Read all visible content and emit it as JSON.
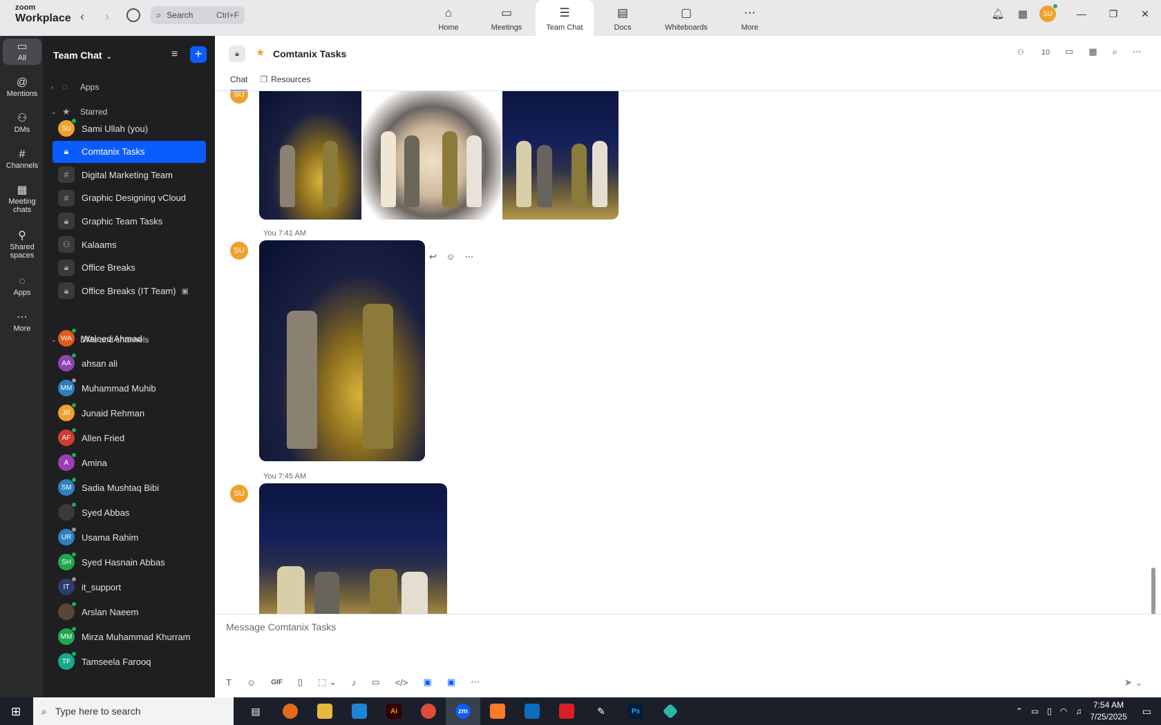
{
  "app": {
    "brand_top": "zoom",
    "brand_bottom": "Workplace"
  },
  "top": {
    "search_label": "Search",
    "search_shortcut": "Ctrl+F",
    "tabs": [
      {
        "label": "Home",
        "icon": "home-icon"
      },
      {
        "label": "Meetings",
        "icon": "video-icon"
      },
      {
        "label": "Team Chat",
        "icon": "chat-icon"
      },
      {
        "label": "Docs",
        "icon": "doc-icon"
      },
      {
        "label": "Whiteboards",
        "icon": "whiteboard-icon"
      },
      {
        "label": "More",
        "icon": "more-icon"
      }
    ],
    "active_tab": "Team Chat",
    "avatar_initials": "SU"
  },
  "rail": [
    {
      "label": "All",
      "icon": "chat-bubble-icon"
    },
    {
      "label": "Mentions",
      "icon": "at-icon"
    },
    {
      "label": "DMs",
      "icon": "people-icon"
    },
    {
      "label": "Channels",
      "icon": "hash-icon"
    },
    {
      "label": "Meeting chats",
      "icon": "calendar-icon"
    },
    {
      "label": "Shared spaces",
      "icon": "share-icon"
    },
    {
      "label": "Apps",
      "icon": "apps-bubble-icon"
    },
    {
      "label": "More",
      "icon": "ellipsis-icon"
    }
  ],
  "sidebar": {
    "title": "Team Chat",
    "sections": {
      "apps": "Apps",
      "starred": "Starred",
      "dms": "DMs and channels"
    },
    "starred": [
      {
        "label": "Sami Ullah (you)",
        "initials": "SU",
        "color": "#f0a02c",
        "kind": "avatar",
        "status": "on"
      },
      {
        "label": "Comtanix Tasks",
        "kind": "lock",
        "active": true
      },
      {
        "label": "Digital Marketing Team",
        "kind": "hash"
      },
      {
        "label": "Graphic Designing vCloud",
        "kind": "hash"
      },
      {
        "label": "Graphic Team Tasks",
        "kind": "lock"
      },
      {
        "label": "Kalaams",
        "kind": "group"
      },
      {
        "label": "Office Breaks",
        "kind": "lock"
      },
      {
        "label": "Office Breaks (IT Team)",
        "kind": "lock",
        "archived": true
      }
    ],
    "dms": [
      {
        "label": "Waleed Ahmad",
        "initials": "WA",
        "color": "#e05a1c",
        "status": "on"
      },
      {
        "label": "ahsan ali",
        "initials": "AA",
        "color": "#8e44ad",
        "status": "on"
      },
      {
        "label": "Muhammad Muhib",
        "initials": "MM",
        "color": "#2d7fc1",
        "status": "off"
      },
      {
        "label": "Junaid Rehman",
        "initials": "JR",
        "color": "#f0a02c",
        "status": "on"
      },
      {
        "label": "Allen Fried",
        "initials": "AF",
        "color": "#d03a2f",
        "status": "on"
      },
      {
        "label": "Amina",
        "initials": "A",
        "color": "#9b3fb5",
        "status": "on"
      },
      {
        "label": "Sadia Mushtaq Bibi",
        "initials": "SM",
        "color": "#2d7fc1",
        "status": "on"
      },
      {
        "label": "Syed Abbas",
        "initials": "",
        "color": "#3a3a3a",
        "status": "on"
      },
      {
        "label": "Usama Rahim",
        "initials": "UR",
        "color": "#2d7fc1",
        "status": "off"
      },
      {
        "label": "Syed Hasnain Abbas",
        "initials": "SH",
        "color": "#1fa84f",
        "status": "on"
      },
      {
        "label": "it_support",
        "initials": "IT",
        "color": "#2b3d6b",
        "status": "off"
      },
      {
        "label": "Arslan Naeem",
        "initials": "",
        "color": "#5a4636",
        "status": "on"
      },
      {
        "label": "Mirza Muhammad Khurram",
        "initials": "MM",
        "color": "#1fa84f",
        "status": "on"
      },
      {
        "label": "Tamseela Farooq",
        "initials": "TF",
        "color": "#18a88f",
        "status": "on"
      }
    ]
  },
  "channel": {
    "title": "Comtanix Tasks",
    "member_count": "10",
    "tabs": {
      "chat": "Chat",
      "resources": "Resources"
    }
  },
  "messages": [
    {
      "author_initials": "SU",
      "meta": "",
      "kind": "gallery"
    },
    {
      "author_initials": "SU",
      "meta": "You 7:41 AM",
      "kind": "photo"
    },
    {
      "author_initials": "SU",
      "meta": "You 7:45 AM",
      "kind": "photo"
    }
  ],
  "composer": {
    "placeholder": "Message Comtanix Tasks",
    "gif_label": "GIF"
  },
  "taskbar": {
    "search_placeholder": "Type here to search",
    "time": "7:54 AM",
    "date": "7/25/2025",
    "apps": [
      {
        "label": "Ai",
        "color": "#330000"
      },
      {
        "label": "zm",
        "color": "#0b5cff"
      },
      {
        "label": "Ps",
        "color": "#001e36"
      }
    ]
  },
  "colors": {
    "accent": "#0b5cff",
    "online": "#19b24b",
    "star": "#f0a02c"
  }
}
